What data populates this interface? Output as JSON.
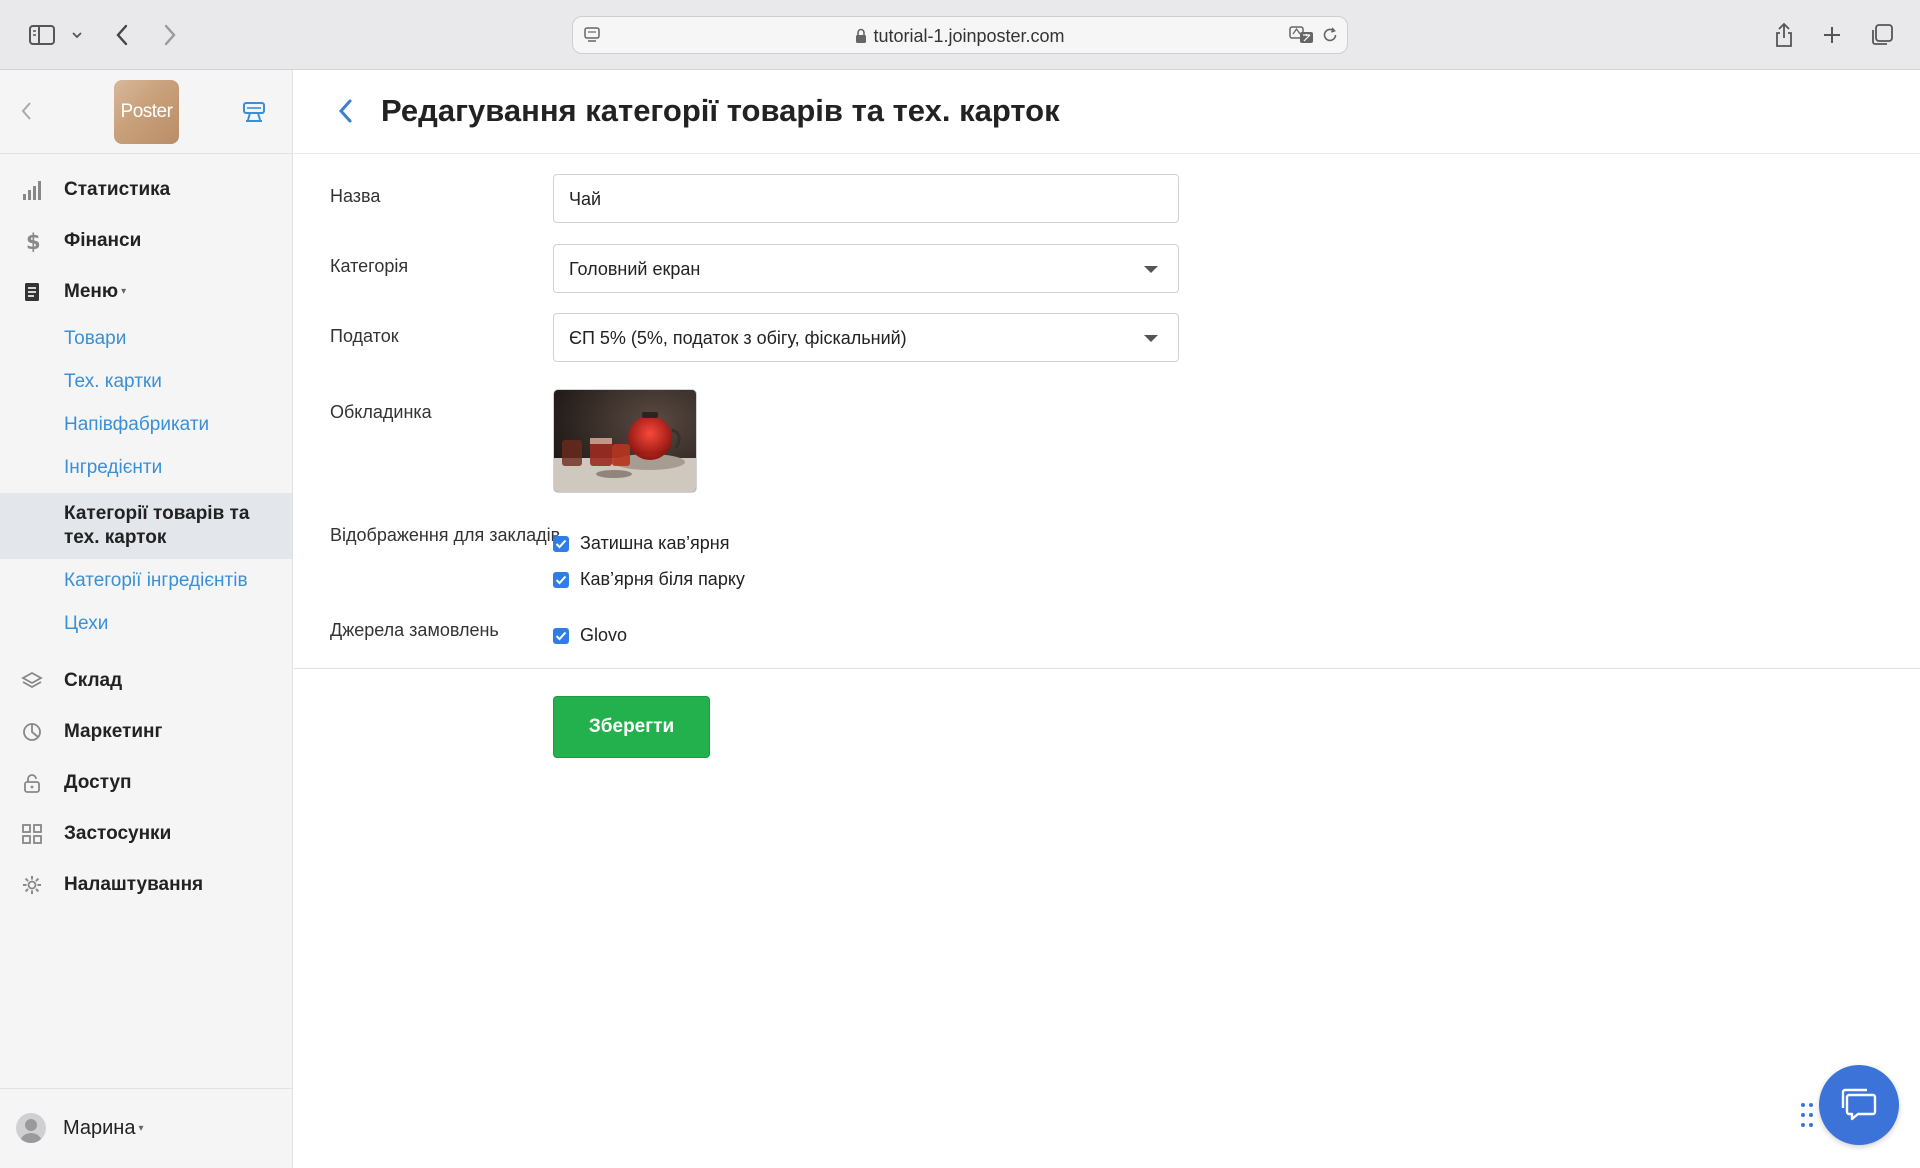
{
  "browser": {
    "url": "tutorial-1.joinposter.com"
  },
  "sidebar": {
    "logo_text": "Poster",
    "items": [
      {
        "label": "Статистика",
        "icon": "bar-chart-icon"
      },
      {
        "label": "Фінанси",
        "icon": "dollar-icon"
      },
      {
        "label": "Меню",
        "icon": "document-icon",
        "expanded": true
      },
      {
        "label": "Склад",
        "icon": "layers-icon"
      },
      {
        "label": "Маркетинг",
        "icon": "pie-icon"
      },
      {
        "label": "Доступ",
        "icon": "lock-icon"
      },
      {
        "label": "Застосунки",
        "icon": "grid-icon"
      },
      {
        "label": "Налаштування",
        "icon": "gear-icon"
      }
    ],
    "menu_subitems": [
      {
        "label": "Товари"
      },
      {
        "label": "Тех. картки"
      },
      {
        "label": "Напівфабрикати"
      },
      {
        "label": "Інгредієнти"
      },
      {
        "label": "Категорії товарів та тех. карток",
        "active": true
      },
      {
        "label": "Категорії інгредієнтів"
      },
      {
        "label": "Цехи"
      }
    ],
    "user": {
      "name": "Марина"
    }
  },
  "page": {
    "title": "Редагування категорії товарів та тех. карток"
  },
  "form": {
    "name_label": "Назва",
    "name_value": "Чай",
    "category_label": "Категорія",
    "category_value": "Головний екран",
    "tax_label": "Податок",
    "tax_value": "ЄП 5% (5%, податок з обігу, фіскальний)",
    "cover_label": "Обкладинка",
    "display_label": "Відображення для закладів",
    "venues": [
      {
        "label": "Затишна кав’ярня",
        "checked": true
      },
      {
        "label": "Кав’ярня біля парку",
        "checked": true
      }
    ],
    "sources_label": "Джерела замовлень",
    "sources": [
      {
        "label": "Glovo",
        "checked": true
      }
    ],
    "save_label": "Зберегти"
  },
  "colors": {
    "accent_link": "#3a8fd6",
    "save_green": "#22b14c",
    "checkbox_blue": "#2f7ee8",
    "chat_blue": "#3b73d8"
  }
}
